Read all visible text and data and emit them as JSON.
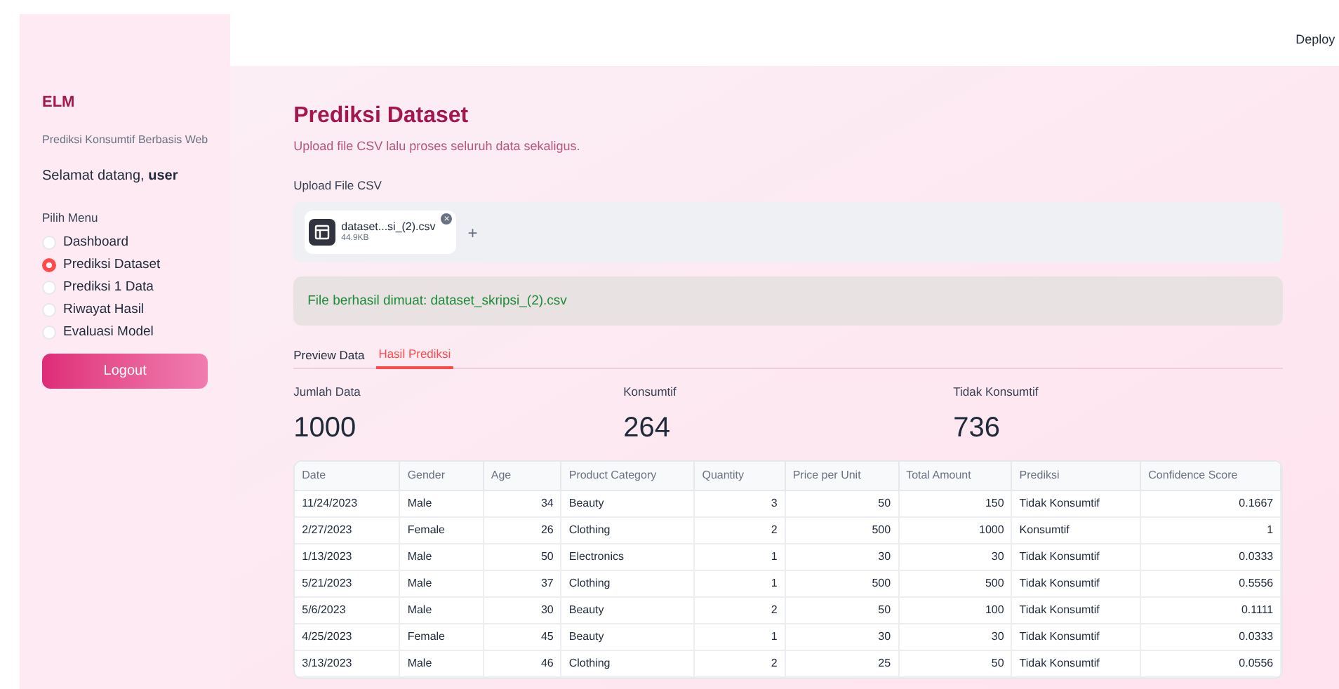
{
  "header": {
    "deploy": "Deploy"
  },
  "sidebar": {
    "brand": "ELM",
    "subtitle": "Prediksi Konsumtif Berbasis Web",
    "greeting": "Selamat datang, **user**",
    "menu_label": "Pilih Menu",
    "menu": [
      {
        "label": "Dashboard",
        "selected": false
      },
      {
        "label": "Prediksi Dataset",
        "selected": true
      },
      {
        "label": "Prediksi 1 Data",
        "selected": false
      },
      {
        "label": "Riwayat Hasil",
        "selected": false
      },
      {
        "label": "Evaluasi Model",
        "selected": false
      }
    ],
    "logout": "Logout"
  },
  "main": {
    "title": "Prediksi Dataset",
    "subtitle": "Upload file CSV lalu proses seluruh data sekaligus.",
    "upload_label": "Upload File CSV",
    "file": {
      "name": "dataset...si_(2).csv",
      "size": "44.9KB",
      "remove": "×",
      "add": "+"
    },
    "success": "File berhasil dimuat: dataset_skripsi_(2).csv",
    "tabs": [
      {
        "label": "Preview Data",
        "selected": false
      },
      {
        "label": "Hasil Prediksi",
        "selected": true
      }
    ],
    "metrics": [
      {
        "label": "Jumlah Data",
        "value": "1000"
      },
      {
        "label": "Konsumtif",
        "value": "264"
      },
      {
        "label": "Tidak Konsumtif",
        "value": "736"
      }
    ],
    "table": {
      "columns": [
        "Date",
        "Gender",
        "Age",
        "Product Category",
        "Quantity",
        "Price per Unit",
        "Total Amount",
        "Prediksi",
        "Confidence Score"
      ],
      "rows": [
        [
          "11/24/2023",
          "Male",
          "34",
          "Beauty",
          "3",
          "50",
          "150",
          "Tidak Konsumtif",
          "0.1667"
        ],
        [
          "2/27/2023",
          "Female",
          "26",
          "Clothing",
          "2",
          "500",
          "1000",
          "Konsumtif",
          "1"
        ],
        [
          "1/13/2023",
          "Male",
          "50",
          "Electronics",
          "1",
          "30",
          "30",
          "Tidak Konsumtif",
          "0.0333"
        ],
        [
          "5/21/2023",
          "Male",
          "37",
          "Clothing",
          "1",
          "500",
          "500",
          "Tidak Konsumtif",
          "0.5556"
        ],
        [
          "5/6/2023",
          "Male",
          "30",
          "Beauty",
          "2",
          "50",
          "100",
          "Tidak Konsumtif",
          "0.1111"
        ],
        [
          "4/25/2023",
          "Female",
          "45",
          "Beauty",
          "1",
          "30",
          "30",
          "Tidak Konsumtif",
          "0.0333"
        ],
        [
          "3/13/2023",
          "Male",
          "46",
          "Clothing",
          "2",
          "25",
          "50",
          "Tidak Konsumtif",
          "0.0556"
        ]
      ]
    }
  }
}
